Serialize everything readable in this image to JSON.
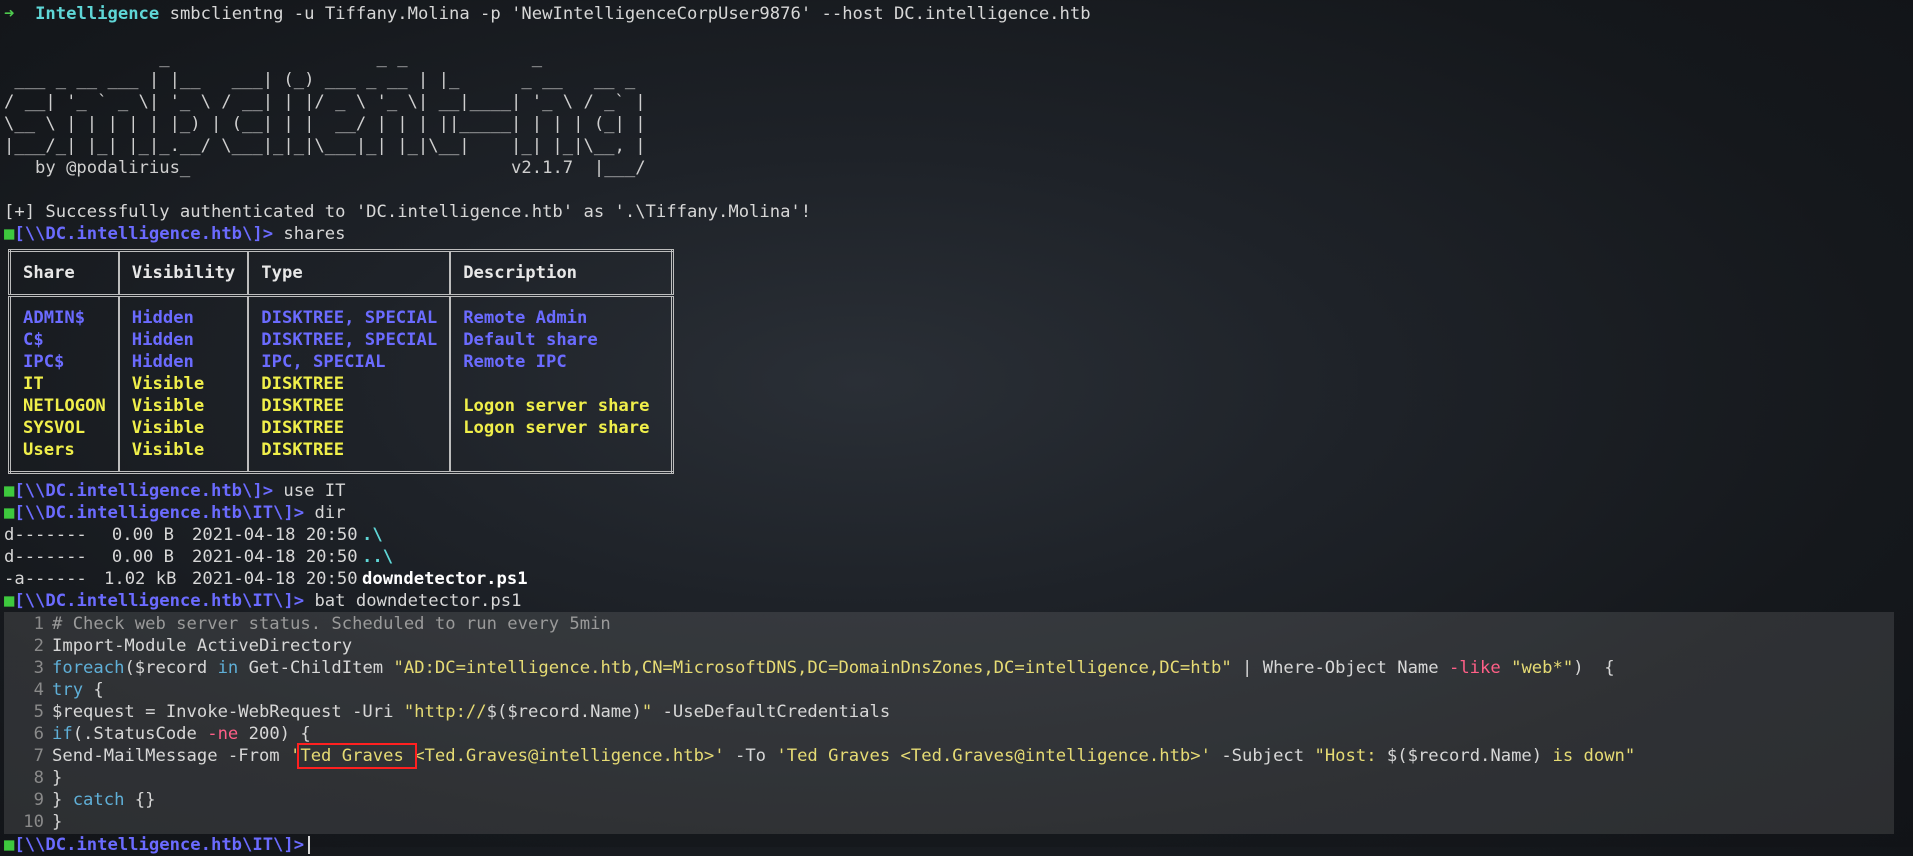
{
  "prompt": {
    "arrow": "➜",
    "dir": "Intelligence",
    "command": "smbclientng -u Tiffany.Molina -p 'NewIntelligenceCorpUser9876' --host DC.intelligence.htb"
  },
  "banner": {
    "lines": [
      "               _                    _ _            _",
      " ___ _ __ ___ | |__   ___| (_) ___ _ __ | |_      _ __   __ _",
      "/ __| '_ ` _ \\| '_ \\ / __| | |/ _ \\ '_ \\| __|____| '_ \\ / _` |",
      "\\__ \\ | | | | | |_) | (__| | |  __/ | | | ||_____| | | | (_| |",
      "|___/_| |_| |_|_.__/ \\___|_|_|\\___|_| |_|\\__|    |_| |_|\\__, |"
    ],
    "by": "   by @podalirius_",
    "version": "v2.1.7",
    "tail": "|___/"
  },
  "auth_message": "[+] Successfully authenticated to 'DC.intelligence.htb' as '.\\Tiffany.Molina'!",
  "smb_prompt_root": "[\\\\DC.intelligence.htb\\]>",
  "smb_prompt_it": "[\\\\DC.intelligence.htb\\IT\\]>",
  "cmd_shares": " shares",
  "cmd_use": " use IT",
  "cmd_dir": " dir",
  "cmd_bat": " bat downdetector.ps1",
  "shares_table": {
    "headers": [
      "Share",
      "Visibility",
      "Type",
      "Description"
    ],
    "rows": [
      {
        "share": "ADMIN$",
        "visibility": "Hidden",
        "type": "DISKTREE, SPECIAL",
        "description": "Remote Admin",
        "color": "blue"
      },
      {
        "share": "C$",
        "visibility": "Hidden",
        "type": "DISKTREE, SPECIAL",
        "description": "Default share",
        "color": "blue"
      },
      {
        "share": "IPC$",
        "visibility": "Hidden",
        "type": "IPC, SPECIAL",
        "description": "Remote IPC",
        "color": "blue"
      },
      {
        "share": "IT",
        "visibility": "Visible",
        "type": "DISKTREE",
        "description": "",
        "color": "yellow"
      },
      {
        "share": "NETLOGON",
        "visibility": "Visible",
        "type": "DISKTREE",
        "description": "Logon server share",
        "color": "yellow"
      },
      {
        "share": "SYSVOL",
        "visibility": "Visible",
        "type": "DISKTREE",
        "description": "Logon server share",
        "color": "yellow"
      },
      {
        "share": "Users",
        "visibility": "Visible",
        "type": "DISKTREE",
        "description": "",
        "color": "yellow"
      }
    ]
  },
  "dir_listing": [
    {
      "perm": "d-------",
      "size": "0.00 B",
      "date": "2021-04-18 20:50",
      "name": ".\\"
    },
    {
      "perm": "d-------",
      "size": "0.00 B",
      "date": "2021-04-18 20:50",
      "name": "..\\"
    },
    {
      "perm": "-a------",
      "size": "1.02 kB",
      "date": "2021-04-18 20:50",
      "name": "downdetector.ps1"
    }
  ],
  "code": {
    "line_numbers": [
      "1",
      "2",
      "3",
      "4",
      "5",
      "6",
      "7",
      "8",
      "9",
      "10"
    ],
    "l1": "# Check web server status. Scheduled to run every 5min",
    "l2": "Import-Module ActiveDirectory",
    "l3_kw": "foreach",
    "l3_a": "($record ",
    "l3_in": "in",
    "l3_b": " Get-ChildItem ",
    "l3_str": "\"AD:DC=intelligence.htb,CN=MicrosoftDNS,DC=DomainDnsZones,DC=intelligence,DC=htb\"",
    "l3_c": " | Where-Object Name ",
    "l3_op": "-like",
    "l3_d": " ",
    "l3_str2": "\"web*\"",
    "l3_e": ")  {",
    "l4_kw": "try",
    "l4_a": " {",
    "l5_a": "$request = Invoke-WebRequest -Uri ",
    "l5_str": "\"http://",
    "l5_b": "$($record.Name)",
    "l5_str2": "\"",
    "l5_c": " -UseDefaultCredentials",
    "l6_kw": "if",
    "l6_a": "(.StatusCode ",
    "l6_op": "-ne",
    "l6_b": " 200) {",
    "l7_a": "Send-MailMessage -From ",
    "l7_q": "'",
    "l7_hl": "Ted Graves ",
    "l7_str": "<Ted.Graves@intelligence.htb>'",
    "l7_b": " -To ",
    "l7_str2": "'Ted Graves <Ted.Graves@intelligence.htb>'",
    "l7_c": " -Subject ",
    "l7_str3": "\"Host: ",
    "l7_d": "$($record.Name)",
    "l7_str4": " is down\"",
    "l8": "}",
    "l9_a": "} ",
    "l9_kw": "catch",
    "l9_b": " {}",
    "l10": "}"
  }
}
